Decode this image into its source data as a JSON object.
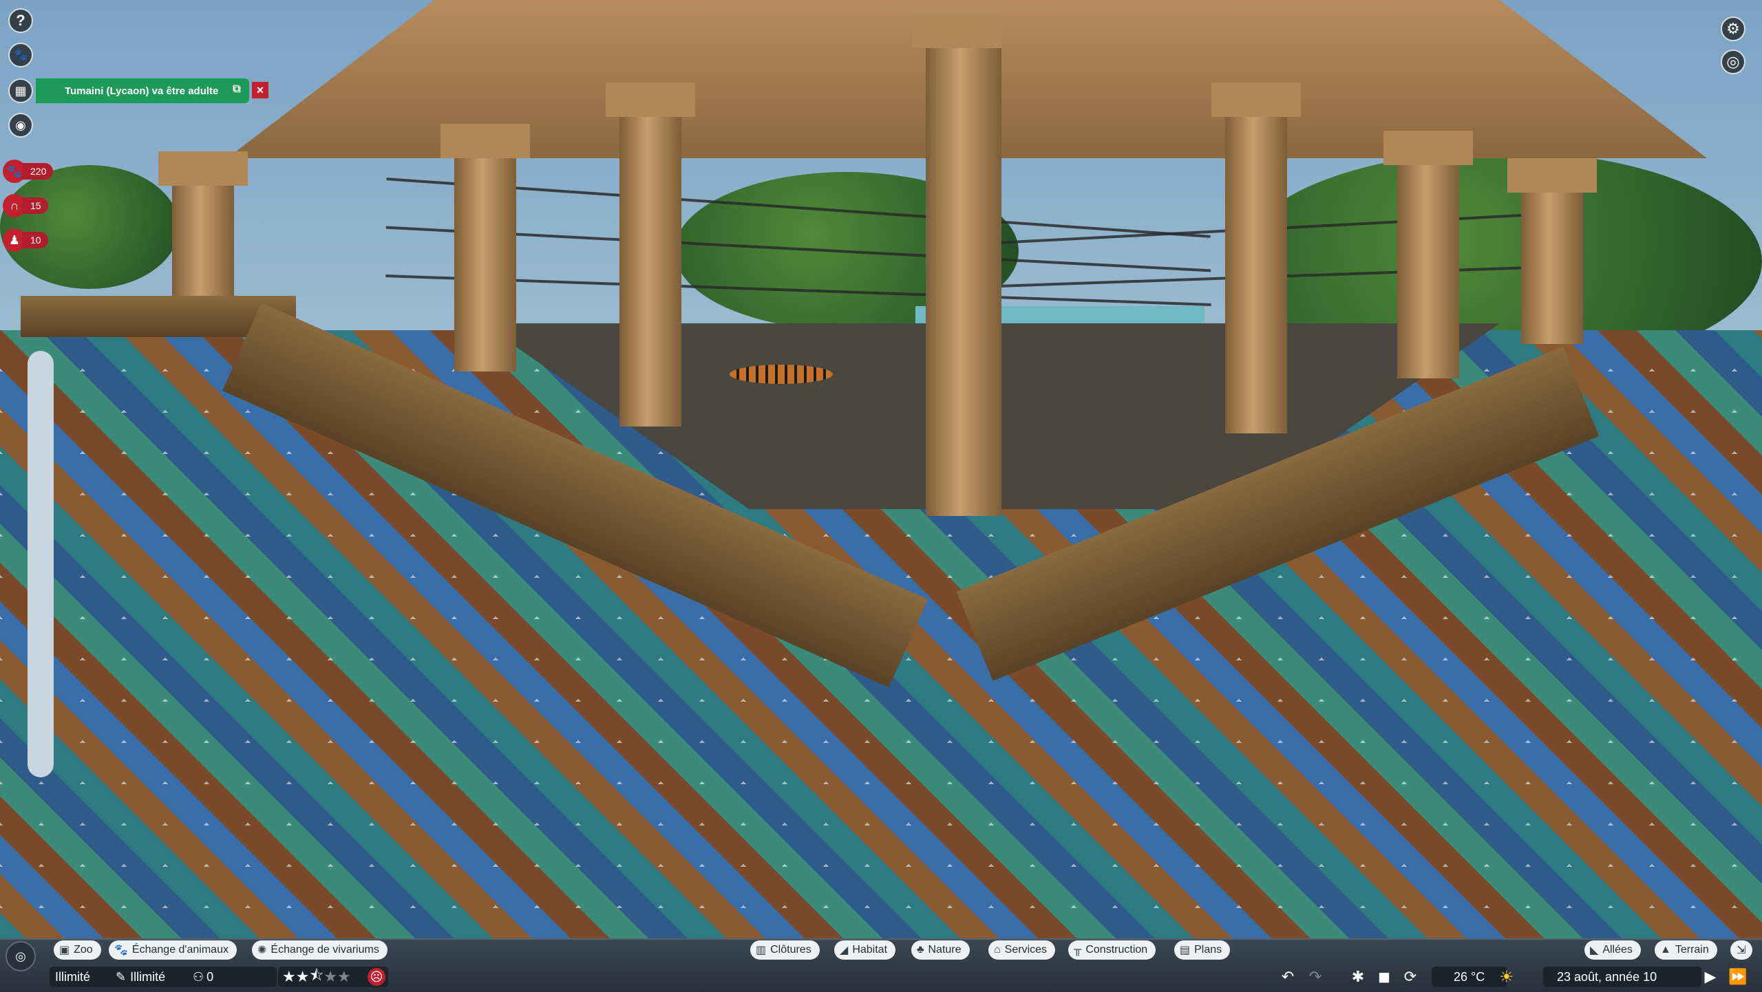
{
  "notification": {
    "text": "Tumaini (Lycaon) va être adulte",
    "external_icon": "external-link-icon",
    "close_icon": "close-icon"
  },
  "left_buttons": [
    {
      "icon": "help-icon",
      "glyph": "?"
    },
    {
      "icon": "animal-face-icon",
      "glyph": "🐾"
    },
    {
      "icon": "calendar-icon",
      "glyph": "▦"
    },
    {
      "icon": "eye-icon",
      "glyph": "◉"
    }
  ],
  "stats": {
    "animals": {
      "icon": "paw-icon",
      "glyph": "🐾",
      "value": "220"
    },
    "habitats": {
      "icon": "gate-icon",
      "glyph": "∩",
      "value": "15"
    },
    "staff": {
      "icon": "staff-icon",
      "glyph": "♟",
      "value": "10"
    }
  },
  "right_buttons": [
    {
      "icon": "settings-gear-icon",
      "glyph": "⚙"
    },
    {
      "icon": "camera-view-icon",
      "glyph": "◎"
    }
  ],
  "bottom_tabs_left": [
    {
      "label": "Zoo",
      "icon": "zoo-icon",
      "glyph": "▣"
    },
    {
      "label": "Échange d'animaux",
      "icon": "paw-exchange-icon",
      "glyph": "🐾"
    },
    {
      "label": "Échange de vivariums",
      "icon": "vivarium-icon",
      "glyph": "✺"
    }
  ],
  "bottom_tabs_center": [
    {
      "label": "Clôtures",
      "icon": "fence-icon",
      "glyph": "▥"
    },
    {
      "label": "Habitat",
      "icon": "habitat-icon",
      "glyph": "◢"
    },
    {
      "label": "Nature",
      "icon": "nature-icon",
      "glyph": "♣"
    },
    {
      "label": "Services",
      "icon": "services-icon",
      "glyph": "⌂"
    },
    {
      "label": "Construction",
      "icon": "construction-icon",
      "glyph": "╥"
    },
    {
      "label": "Plans",
      "icon": "plans-icon",
      "glyph": "▤"
    }
  ],
  "bottom_tabs_right": [
    {
      "label": "Allées",
      "icon": "paths-icon",
      "glyph": "◣"
    },
    {
      "label": "Terrain",
      "icon": "terrain-icon",
      "glyph": "▲"
    }
  ],
  "status": {
    "money": "Illimité",
    "research": "Illimité",
    "research_icon": "research-icon",
    "guests": "0",
    "guests_icon": "guests-icon",
    "rating": 2.5,
    "rating_max": 5,
    "mood_icon": "sad-face-icon",
    "temperature": "26 °C",
    "weather_icon": "sun-icon",
    "date": "23 août, année 10"
  },
  "controls": {
    "undo_icon": "undo-icon",
    "redo_icon": "redo-icon",
    "speed_icons": [
      "speed-dial-icon",
      "pause-icon",
      "fast-forward-dial-icon"
    ],
    "play_icons": [
      "play-icon",
      "fast-play-icon"
    ]
  }
}
